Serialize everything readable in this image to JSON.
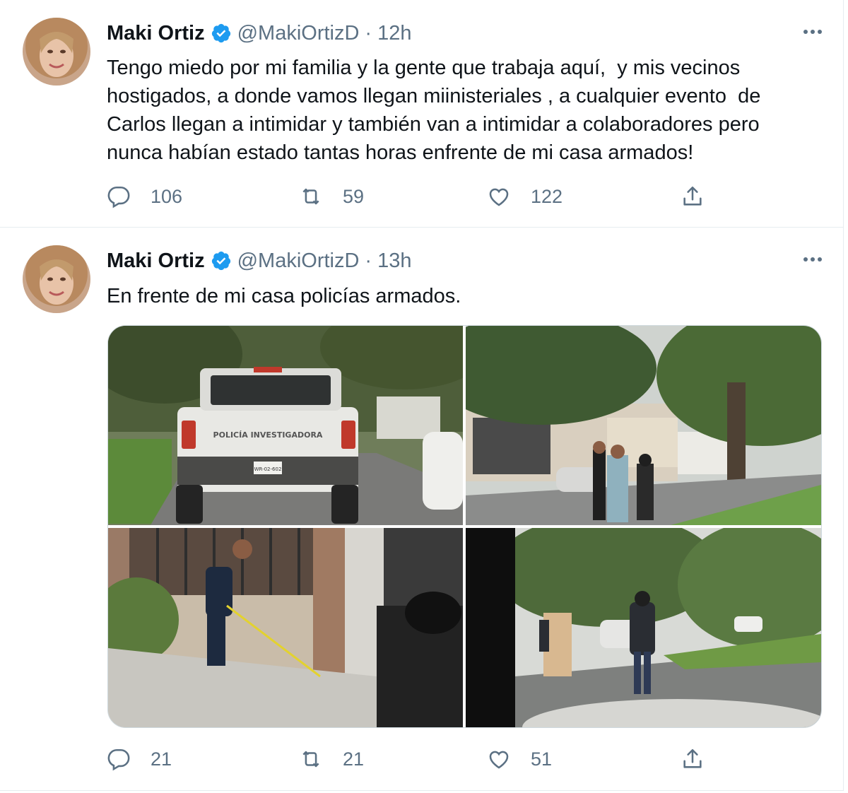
{
  "colors": {
    "accent": "#1d9bf0",
    "muted": "#5b7083",
    "text": "#0f1419",
    "border": "#e6ecf0"
  },
  "tweets": [
    {
      "author": {
        "name": "Maki Ortiz",
        "handle": "@MakiOrtizD",
        "verified_icon": "verified-badge-icon"
      },
      "separator": "·",
      "time": "12h",
      "text": "Tengo miedo por mi familia y la gente que trabaja aquí,  y mis vecinos\nhostigados, a donde vamos llegan miinisteriales , a cualquier evento  de\nCarlos llegan a intimidar y también van a intimidar a colaboradores pero\nnunca habían estado tantas horas enfrente de mi casa armados!",
      "stats": {
        "replies": "106",
        "retweets": "59",
        "likes": "122"
      }
    },
    {
      "author": {
        "name": "Maki Ortiz",
        "handle": "@MakiOrtizD",
        "verified_icon": "verified-badge-icon"
      },
      "separator": "·",
      "time": "13h",
      "text": "En frente de mi casa policías armados.",
      "photos": [
        {
          "id": "photo-1",
          "vehicle_text": "POLICÍA INVESTIGADORA",
          "plate_text": "WR-02-602"
        },
        {
          "id": "photo-2"
        },
        {
          "id": "photo-3"
        },
        {
          "id": "photo-4"
        }
      ],
      "stats": {
        "replies": "21",
        "retweets": "21",
        "likes": "51"
      }
    }
  ]
}
